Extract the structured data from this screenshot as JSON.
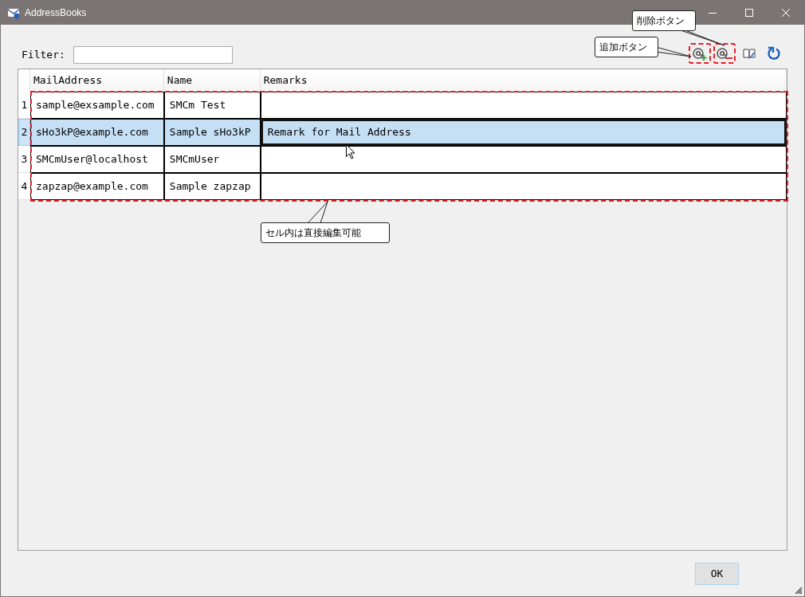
{
  "window": {
    "title": "AddressBooks"
  },
  "filter": {
    "label": "Filter:"
  },
  "toolbar": [
    {
      "kind": "add",
      "highlighted": true
    },
    {
      "kind": "delete",
      "highlighted": true
    },
    {
      "kind": "edit",
      "highlighted": false
    },
    {
      "kind": "refresh",
      "highlighted": false
    }
  ],
  "table": {
    "columns": [
      "MailAddress",
      "Name",
      "Remarks"
    ],
    "rows": [
      {
        "number": "1",
        "selected": false,
        "cells": [
          {
            "text": "sample@exsample.com",
            "focused": false
          },
          {
            "text": "SMCm Test",
            "focused": false
          },
          {
            "text": "",
            "focused": false
          }
        ]
      },
      {
        "number": "2",
        "selected": true,
        "cells": [
          {
            "text": "sHo3kP@example.com",
            "focused": false
          },
          {
            "text": "Sample sHo3kP",
            "focused": false
          },
          {
            "text": "Remark for Mail Address",
            "focused": true
          }
        ]
      },
      {
        "number": "3",
        "selected": false,
        "cells": [
          {
            "text": "SMCmUser@localhost",
            "focused": false
          },
          {
            "text": "SMCmUser",
            "focused": false
          },
          {
            "text": "",
            "focused": false
          }
        ]
      },
      {
        "number": "4",
        "selected": false,
        "cells": [
          {
            "text": "zapzap@example.com",
            "focused": false
          },
          {
            "text": "Sample zapzap",
            "focused": false
          },
          {
            "text": "",
            "focused": false
          }
        ]
      }
    ]
  },
  "callouts": [
    {
      "text": "削除ボタン",
      "kind": "delete"
    },
    {
      "text": "追加ボタン",
      "kind": "add"
    },
    {
      "text": "セル内は直接編集可能",
      "kind": "cells"
    }
  ],
  "buttons": [
    {
      "label": "OK"
    }
  ]
}
